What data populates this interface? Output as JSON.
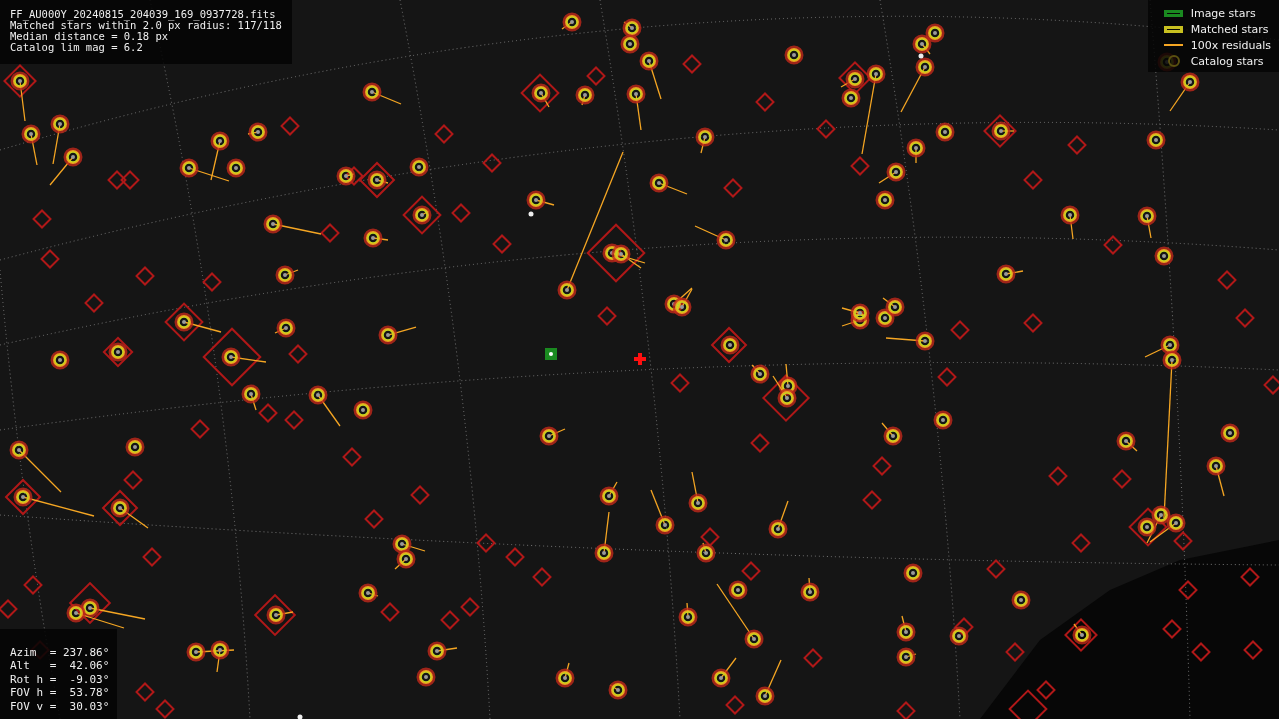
{
  "file_info": {
    "lines": [
      "FF_AU000Y_20240815_204039_169_0937728.fits",
      "Matched stars within 2.0 px radius: 117/118",
      "Median distance = 0.18 px",
      "Catalog lim mag = 6.2"
    ]
  },
  "legend": [
    {
      "kind": "image",
      "label": "Image stars"
    },
    {
      "kind": "matched",
      "label": "Matched stars"
    },
    {
      "kind": "residual",
      "label": "100x residuals"
    },
    {
      "kind": "catalog",
      "label": "Catalog stars"
    }
  ],
  "pointing": {
    "lines": [
      "Azim  = 237.86°",
      "Alt   =  42.06°",
      "Rot h =  -9.03°",
      "FOV h =  53.78°",
      "FOV v =  30.03°"
    ]
  }
}
